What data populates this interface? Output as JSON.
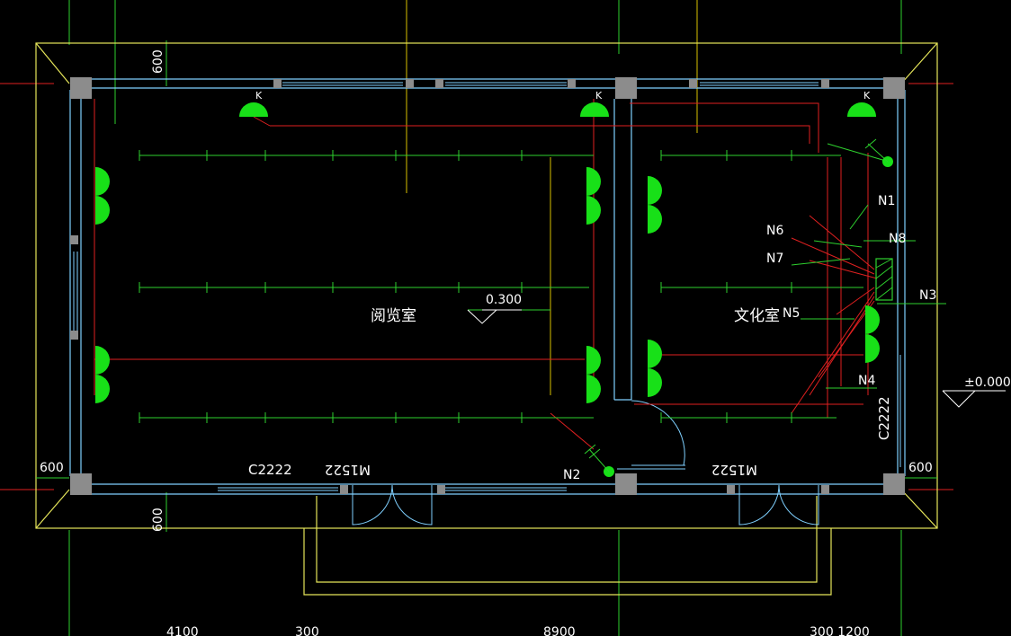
{
  "rooms": {
    "reading_room": "阅览室",
    "culture_room": "文化室"
  },
  "elevations": {
    "inner": "0.300",
    "outer": "±0.000"
  },
  "dimensions": {
    "top_offset": "600",
    "left_offset": "600",
    "right_offset": "600",
    "bottom_offset": "600",
    "bottom_left": "4100",
    "bottom_300a": "300",
    "bottom_mid": "8900",
    "bottom_right": "300 1200"
  },
  "openings": {
    "window_bottom": "C2222",
    "window_right": "C2222",
    "door_left": "M1522",
    "door_right": "M1522"
  },
  "nodes": {
    "n1": "N1",
    "n2": "N2",
    "n3": "N3",
    "n4": "N4",
    "n5": "N5",
    "n6": "N6",
    "n7": "N7",
    "n8": "N8"
  },
  "socket_marks": {
    "k1": "K",
    "k2": "K",
    "k3": "K"
  },
  "colors": {
    "background": "#000000",
    "eaves": "#e6e65a",
    "wall": "#7fd0ff",
    "column": "#8c8c8c",
    "wiring": "#e02020",
    "lamp_line": "#2ed12e",
    "fixture": "#18e018",
    "axis": "#d8c000",
    "text": "#ffffff"
  }
}
